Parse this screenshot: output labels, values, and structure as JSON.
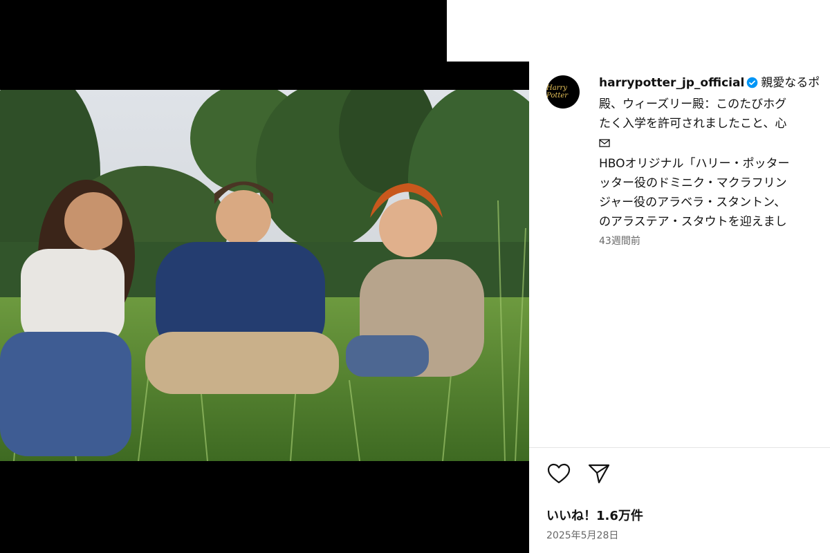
{
  "post": {
    "username": "harrypotter_jp_official",
    "avatar_text": "Harry Potter",
    "caption_lines": [
      "親愛なるポ",
      "殿、ウィーズリー殿：このたびホグ",
      "たく入学を許可されましたこと、心",
      "",
      "HBOオリジナル「ハリー・ポッター",
      "ッター役のドミニク・マクラフリン",
      "ジャー役のアラベラ・スタントン、",
      "のアラステア・スタウトを迎えまし"
    ],
    "time_ago": "43週間前",
    "likes": "いいね！1.6万件",
    "date": "2025年5月28日"
  },
  "icons": {
    "verified": "verified-badge-icon",
    "mail": "envelope-icon",
    "like": "heart-icon",
    "share": "send-icon"
  },
  "colors": {
    "verified": "#0095f6",
    "text": "#111111",
    "muted": "#666666"
  }
}
